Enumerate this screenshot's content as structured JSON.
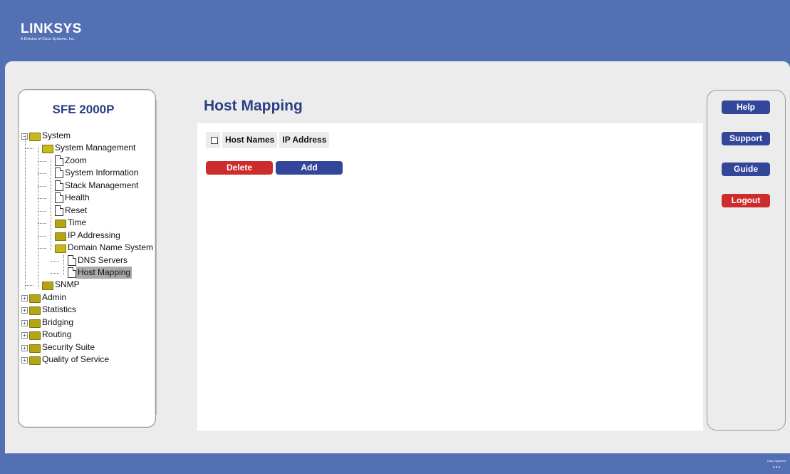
{
  "brand": {
    "logo_text": "LINKSYS",
    "logo_subtext": "A Division of Cisco Systems, Inc.",
    "footer_logo": "Cisco Systems"
  },
  "device": {
    "model": "SFE 2000P"
  },
  "tree": [
    {
      "label": "System",
      "type": "folder-open",
      "expander": "−"
    },
    {
      "label": "System Management",
      "type": "folder-open"
    },
    {
      "label": "Zoom",
      "type": "doc"
    },
    {
      "label": "System Information",
      "type": "doc"
    },
    {
      "label": "Stack Management",
      "type": "doc"
    },
    {
      "label": "Health",
      "type": "doc"
    },
    {
      "label": "Reset",
      "type": "doc"
    },
    {
      "label": "Time",
      "type": "folder"
    },
    {
      "label": "IP Addressing",
      "type": "folder"
    },
    {
      "label": "Domain Name System",
      "type": "folder-open"
    },
    {
      "label": "DNS Servers",
      "type": "doc"
    },
    {
      "label": "Host Mapping",
      "type": "doc",
      "selected": true
    },
    {
      "label": "SNMP",
      "type": "folder"
    },
    {
      "label": "Admin",
      "type": "folder",
      "expander": "+"
    },
    {
      "label": "Statistics",
      "type": "folder",
      "expander": "+"
    },
    {
      "label": "Bridging",
      "type": "folder",
      "expander": "+"
    },
    {
      "label": "Routing",
      "type": "folder",
      "expander": "+"
    },
    {
      "label": "Security Suite",
      "type": "folder",
      "expander": "+"
    },
    {
      "label": "Quality of Service",
      "type": "folder",
      "expander": "+"
    }
  ],
  "main": {
    "title": "Host Mapping",
    "table": {
      "columns": [
        "Host Names",
        "IP Address"
      ],
      "rows": []
    },
    "delete_label": "Delete",
    "add_label": "Add"
  },
  "side": {
    "help": "Help",
    "support": "Support",
    "guide": "Guide",
    "logout": "Logout"
  },
  "colors": {
    "banner": "#5470b4",
    "title": "#2a3f86",
    "primary_button": "#33479a",
    "danger_button": "#cc2c2c",
    "selected_row": "#a9a9a9"
  }
}
